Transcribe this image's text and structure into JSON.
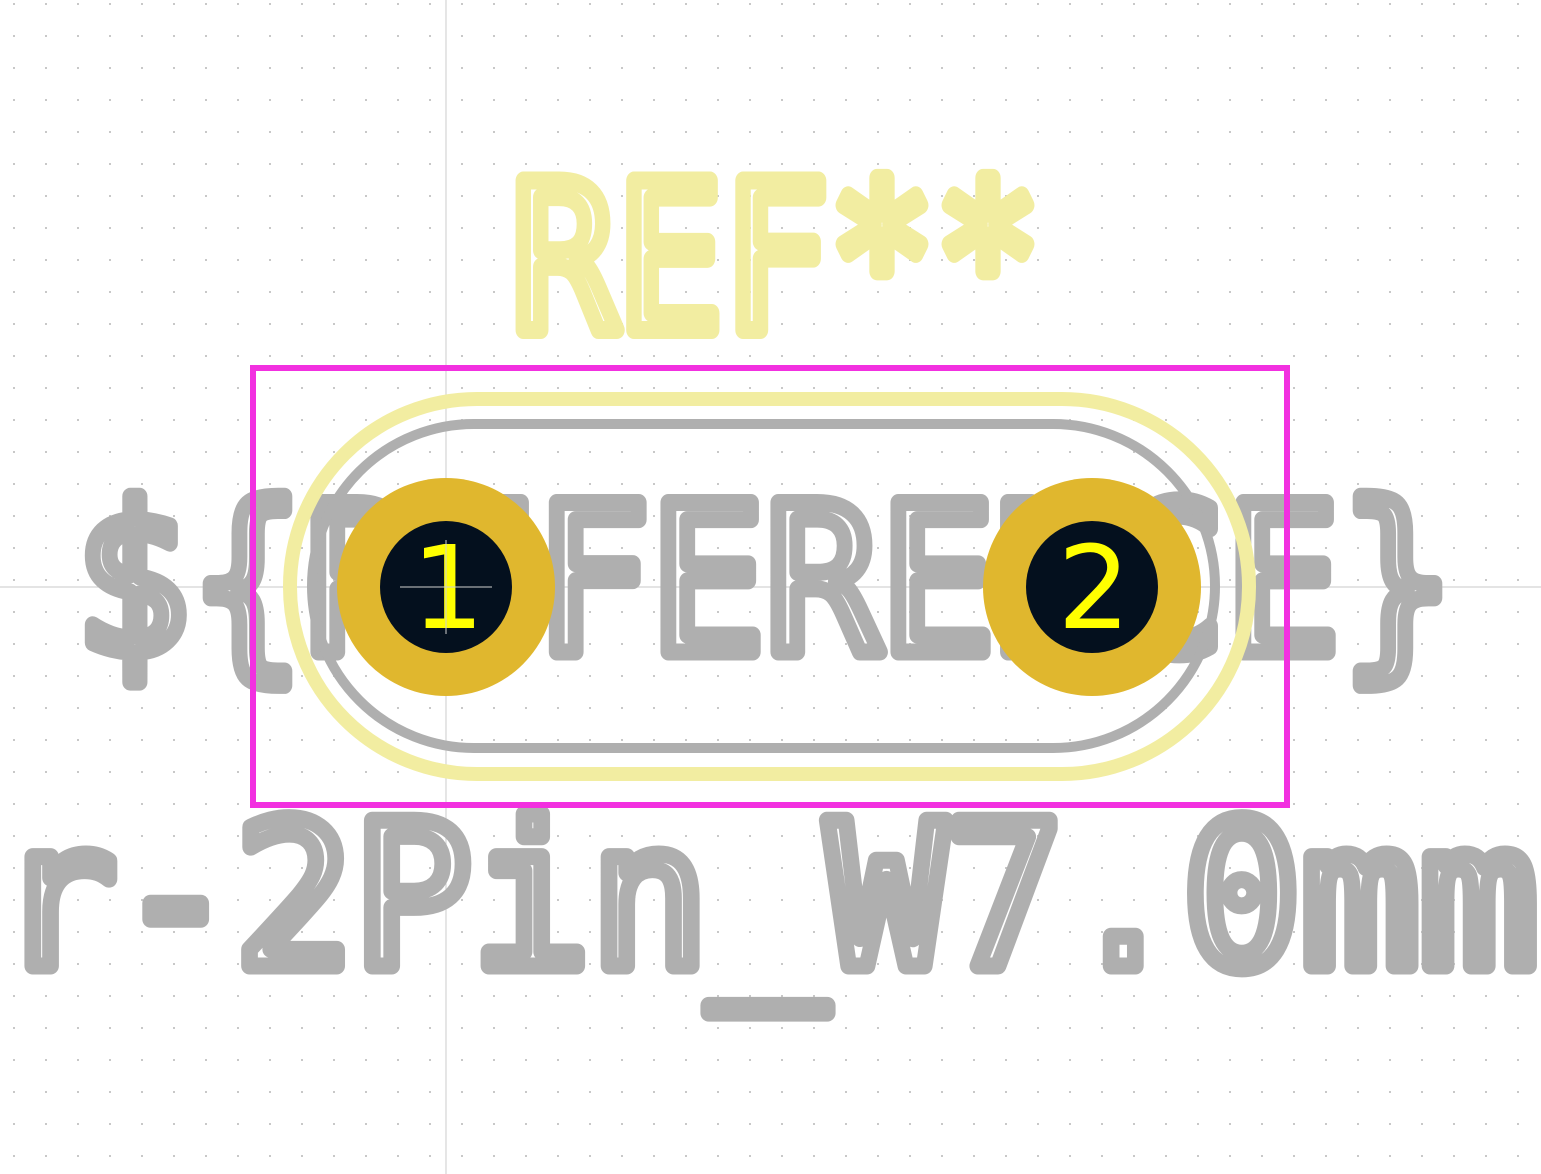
{
  "footprint": {
    "reference_text": "REF**",
    "ref_variable_text": "${REFERENCE}",
    "value_text": "r-2Pin_W7.0mm",
    "pads": [
      {
        "number": "1"
      },
      {
        "number": "2"
      }
    ]
  },
  "colors": {
    "background": "#ffffff",
    "grid_dot": "#c8c8c8",
    "crosshair": "#cfcfcf",
    "silkscreen": "#f2eda1",
    "fabrication": "#afafaf",
    "courtyard": "#f230e0",
    "pad_copper": "#e0b72e",
    "pad_hole": "#04101e",
    "pad_number": "#ffff00"
  }
}
